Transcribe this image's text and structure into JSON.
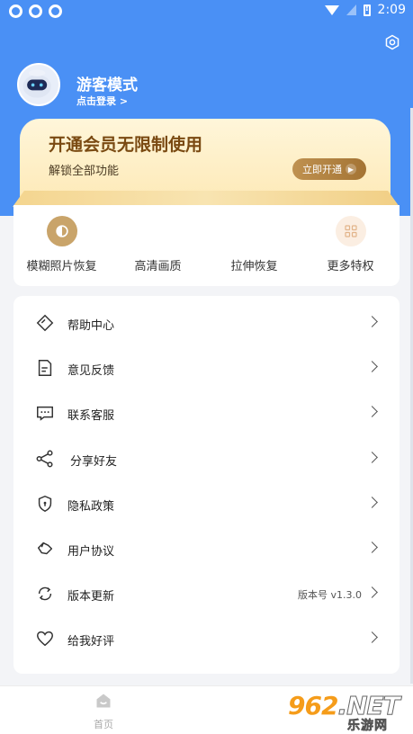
{
  "status_bar": {
    "time": "2:09",
    "left_icons": [
      "app-notification-icon",
      "app-notification-icon",
      "app-notification-icon"
    ],
    "right_icons": [
      "wifi-icon",
      "cell-signal-icon",
      "battery-alert-icon"
    ]
  },
  "header": {
    "background": "#4a90f5",
    "settings_icon": "settings-icon"
  },
  "profile": {
    "name": "游客模式",
    "login_link": "点击登录 >",
    "avatar_icon": "robot-avatar-icon"
  },
  "vip": {
    "title": "开通会员无限制使用",
    "subtitle": "解锁全部功能",
    "button_label": "立即开通",
    "button_color": "#b1823f"
  },
  "features": [
    {
      "label": "模糊照片恢复",
      "icon": "contrast-icon",
      "icon_bg": "#c9a46a"
    },
    {
      "label": "高清画质",
      "icon": "",
      "icon_bg": ""
    },
    {
      "label": "拉伸恢复",
      "icon": "",
      "icon_bg": ""
    },
    {
      "label": "更多特权",
      "icon": "grid-icon",
      "icon_bg": "#fbeee2"
    }
  ],
  "menu": [
    {
      "label": "帮助中心",
      "icon": "help-diamond-icon",
      "value": ""
    },
    {
      "label": "意见反馈",
      "icon": "feedback-document-icon",
      "value": ""
    },
    {
      "label": "联系客服",
      "icon": "chat-bubble-icon",
      "value": ""
    },
    {
      "label": "分享好友",
      "icon": "share-icon",
      "value": ""
    },
    {
      "label": "隐私政策",
      "icon": "privacy-shield-icon",
      "value": ""
    },
    {
      "label": "用户协议",
      "icon": "agreement-icon",
      "value": ""
    },
    {
      "label": "版本更新",
      "icon": "refresh-icon",
      "value": "版本号 v1.3.0"
    },
    {
      "label": "给我好评",
      "icon": "heart-icon",
      "value": ""
    }
  ],
  "bottom_nav": {
    "home_label": "首页",
    "home_icon": "home-icon"
  },
  "watermark": {
    "brand": "962",
    "suffix": ".NET",
    "sub": "乐游网"
  }
}
